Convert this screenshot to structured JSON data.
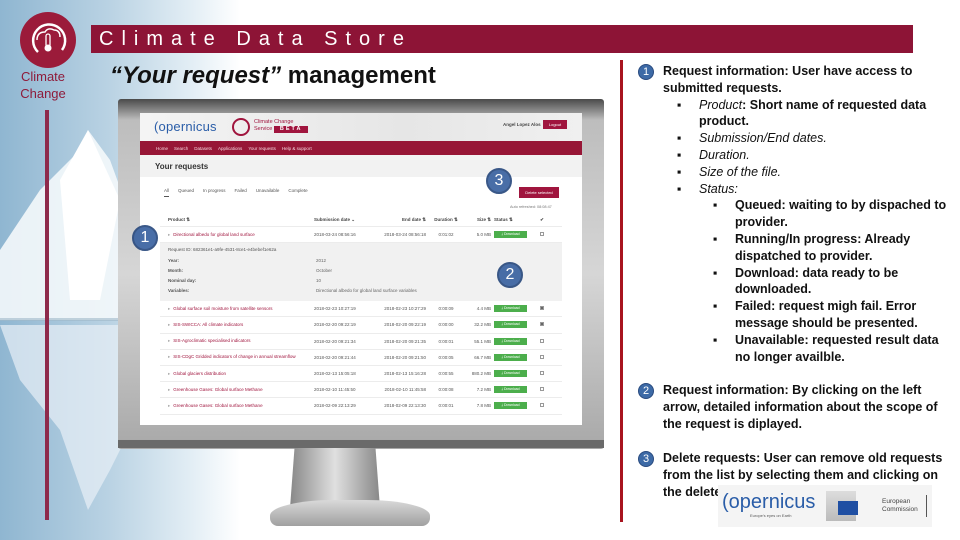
{
  "slide": {
    "logo": {
      "icon": "thermometer-cloud-icon",
      "label_line1": "Climate",
      "label_line2": "Change"
    },
    "title": "Climate Data Store",
    "subtitle_quoted": "“Your request”",
    "subtitle_rest": " management"
  },
  "screen": {
    "header": {
      "copernicus_logo": "opernicus",
      "c3s_line1": "Climate Change",
      "c3s_line2": "Service",
      "beta": "BETA",
      "user_name": "Angel Lopez Alos",
      "logout_label": "Logout"
    },
    "nav": [
      "Home",
      "Search",
      "Datasets",
      "Applications",
      "Your requests",
      "Help & support"
    ],
    "page_title": "Your requests",
    "tabs": [
      "All",
      "Queued",
      "In progress",
      "Failed",
      "Unavailable",
      "Complete"
    ],
    "active_tab": "All",
    "delete_button": "Delete selected",
    "auto_refresh": "Auto refreshed: 08:08:47",
    "table": {
      "headers": {
        "product": "Product ⇅",
        "submission": "Submission date ⌄",
        "end": "End date ⇅",
        "duration": "Duration ⇅",
        "size": "Size ⇅",
        "status": "Status ⇅",
        "check": "✔"
      },
      "expanded_row": {
        "product": "Directional albedo for global land surface",
        "submission": "2018-03-24 08:56:16",
        "end": "2018-03-24 08:56:18",
        "duration": "0:01:02",
        "size": "5.0 MB",
        "status": "Download",
        "checked": false,
        "request_id": "Request ID: 682361e1-a9fe-4531-8ce1-e4bebef1e62a",
        "details": [
          {
            "key": "Year:",
            "value": "2012"
          },
          {
            "key": "Month:",
            "value": "October"
          },
          {
            "key": "Nominal day:",
            "value": "10"
          },
          {
            "key": "Variables:",
            "value": "Directional albedo for global land surface variables"
          }
        ]
      },
      "rows": [
        {
          "product": "Global surface soil moisture from satellite sensors",
          "submission": "2018-02-23 10:27:19",
          "end": "2018-02-23 10:27:29",
          "duration": "0:00:09",
          "size": "4.4 MB",
          "status": "Download",
          "checked": true
        },
        {
          "product": "SIS-SWICCA: All climate indicators",
          "submission": "2018-02-20 09:22:19",
          "end": "2018-02-20 09:22:19",
          "duration": "0:00:00",
          "size": "32.2 MB",
          "status": "Download",
          "checked": true
        },
        {
          "product": "SIS-Agroclimatic specialised indicators",
          "submission": "2018-02-20 09:21:34",
          "end": "2018-02-20 09:21:35",
          "duration": "0:00:01",
          "size": "55.1 MB",
          "status": "Download",
          "checked": false
        },
        {
          "product": "SIS-CDgC Gridded indicators of change in annual streamflow",
          "submission": "2018-02-20 09:21:44",
          "end": "2018-02-20 09:21:50",
          "duration": "0:00:05",
          "size": "66.7 MB",
          "status": "Download",
          "checked": false
        },
        {
          "product": "Global glaciers distribution",
          "submission": "2018-02-13 15:05:18",
          "end": "2018-02-13 15:16:28",
          "duration": "0:00:55",
          "size": "880.2 MB",
          "status": "Download",
          "checked": false
        },
        {
          "product": "Greenhouse Gases: Global surface Methane",
          "submission": "2018-02-10 11:45:50",
          "end": "2018-02-10 11:45:58",
          "duration": "0:00:08",
          "size": "7.2 MB",
          "status": "Download",
          "checked": false
        },
        {
          "product": "Greenhouse Gases: Global surface Methane",
          "submission": "2018-02-09 22:13:29",
          "end": "2018-02-09 22:13:30",
          "duration": "0:00:01",
          "size": "7.8 MB",
          "status": "Download",
          "checked": false
        }
      ]
    },
    "callouts": [
      "1",
      "2",
      "3"
    ]
  },
  "notes": {
    "n1": {
      "num": "1",
      "intro": "Request information: User have access to submitted requests.",
      "items": [
        {
          "term": "Product",
          "text": ": Short name of requested data product."
        },
        {
          "term": "",
          "text": "Submission/End dates."
        },
        {
          "term": "",
          "text": "Duration."
        },
        {
          "term": "",
          "text": "Size of the file."
        },
        {
          "term": "",
          "text": "Status:"
        }
      ],
      "statuses": [
        "Queued: waiting to by dispached to provider.",
        "Running/In progress: Already dispatched to provider.",
        "Download: data ready to be downloaded.",
        "Failed: request migh fail. Error message should be presented.",
        "Unavailable: requested result data no longer availble."
      ]
    },
    "n2": {
      "num": "2",
      "text": "Request information: By clicking on the left arrow, detailed information about the scope of the request is diplayed."
    },
    "n3": {
      "num": "3",
      "text": "Delete requests: User can remove old requests from the list by selecting them and clicking on the delete function."
    }
  },
  "footer": {
    "copernicus": "opernicus",
    "copernicus_tagline": "Europe's eyes on Earth",
    "ec_line1": "European",
    "ec_line2": "Commission"
  },
  "colors": {
    "brand_red": "#8d1436",
    "accent_blue": "#3a62a0",
    "download_green": "#4cae4c",
    "divider_red": "#a8141f"
  }
}
